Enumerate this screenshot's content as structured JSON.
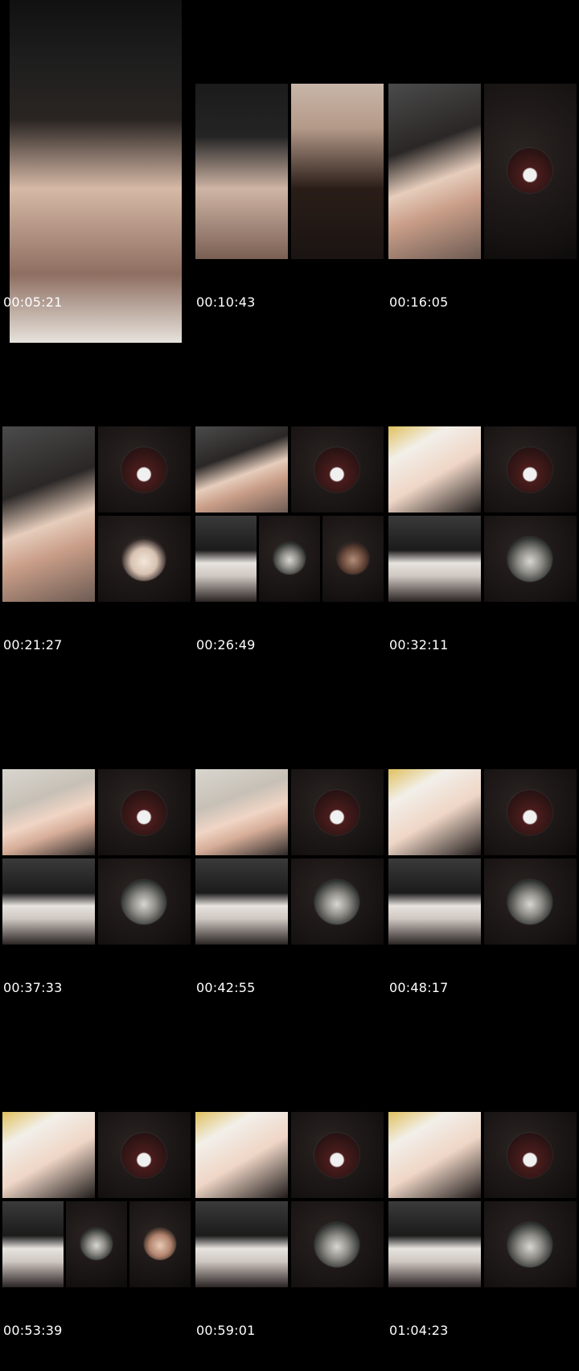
{
  "thumbnails": [
    {
      "timestamp": "00:05:21"
    },
    {
      "timestamp": "00:10:43"
    },
    {
      "timestamp": "00:16:05"
    },
    {
      "timestamp": "00:21:27"
    },
    {
      "timestamp": "00:26:49"
    },
    {
      "timestamp": "00:32:11"
    },
    {
      "timestamp": "00:37:33"
    },
    {
      "timestamp": "00:42:55"
    },
    {
      "timestamp": "00:48:17"
    },
    {
      "timestamp": "00:53:39"
    },
    {
      "timestamp": "00:59:01"
    },
    {
      "timestamp": "01:04:23"
    }
  ]
}
